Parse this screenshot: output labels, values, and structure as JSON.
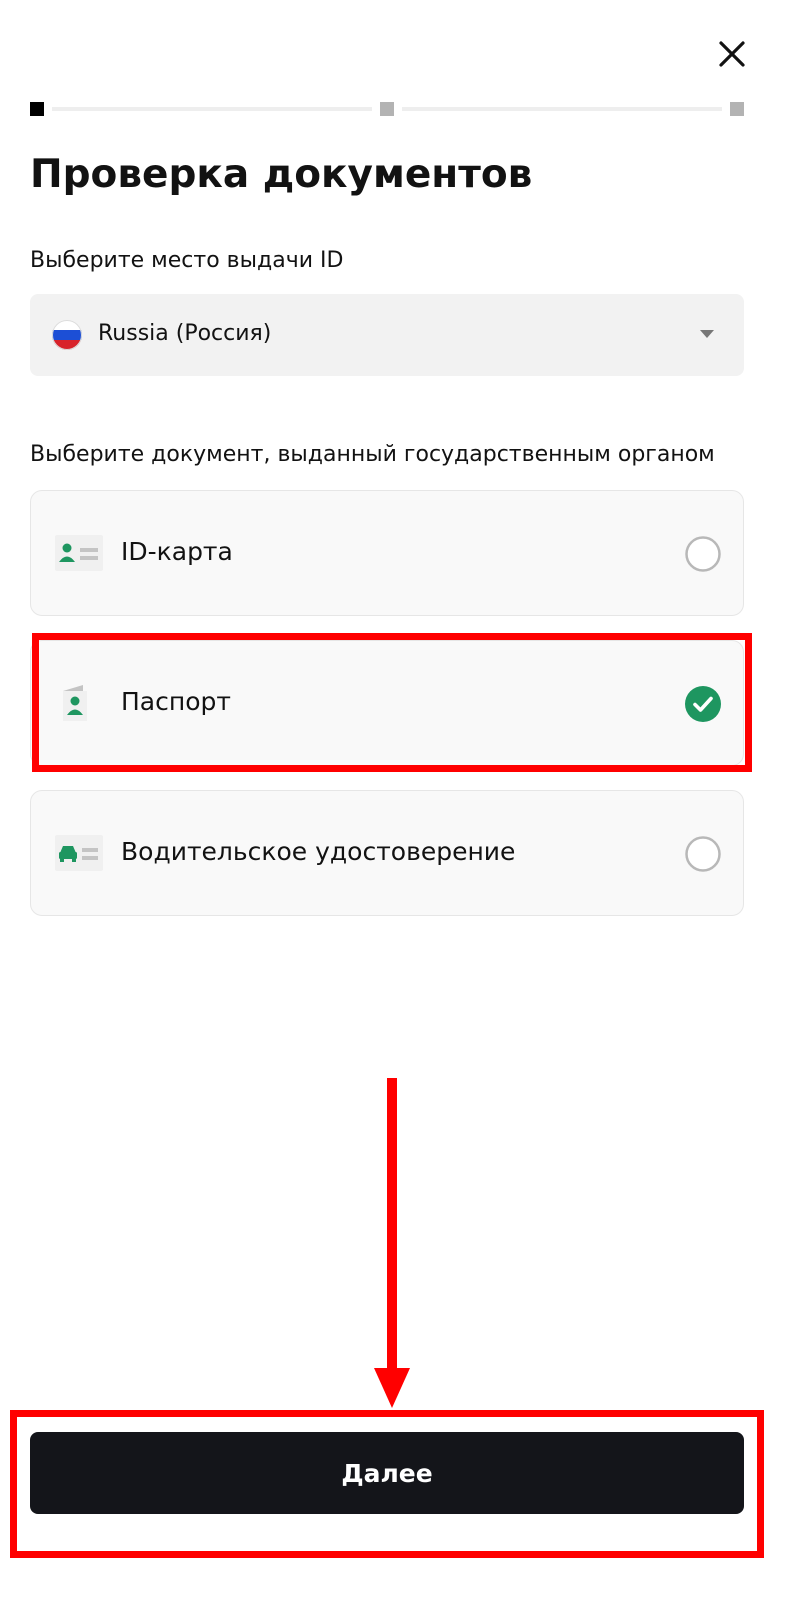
{
  "header": {
    "close_icon": "close-icon",
    "progress": {
      "current_step": 1,
      "total_steps": 3,
      "active_color": "#000000",
      "inactive_color": "#b3b3b3"
    }
  },
  "title": "Проверка документов",
  "issuing_country": {
    "label": "Выберите место выдачи ID",
    "selected_value": "Russia (Россия)",
    "flag_icon": "russia-flag-icon",
    "dropdown_icon": "caret-down-icon"
  },
  "documents": {
    "label": "Выберите документ, выданный государственным органом",
    "options": [
      {
        "label": "ID-карта",
        "icon": "id-card-icon",
        "selected": false
      },
      {
        "label": "Паспорт",
        "icon": "passport-icon",
        "selected": true
      },
      {
        "label": "Водительское удостоверение",
        "icon": "drivers-license-icon",
        "selected": false
      }
    ]
  },
  "next_button": {
    "label": "Далее"
  },
  "colors": {
    "accent_green": "#1e9660",
    "annotation_red": "#ff0000",
    "button_dark": "#14151a"
  }
}
